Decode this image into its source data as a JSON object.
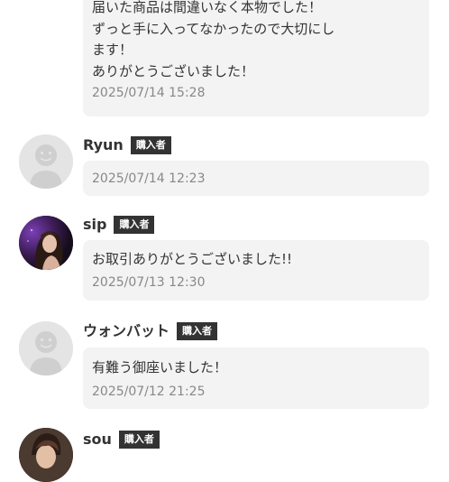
{
  "reviews": [
    {
      "name": "",
      "badge": "",
      "message_lines": [
        "届いた商品は間違いなく本物でした！",
        "ずっと手に入ってなかったので大切にし",
        "ます！",
        "ありがとうございました！"
      ],
      "timestamp": "2025/07/14 15:28"
    },
    {
      "name": "Ryun",
      "badge": "購入者",
      "avatar": "default-person-icon",
      "message_lines": [],
      "timestamp": "2025/07/14 12:23"
    },
    {
      "name": "sip",
      "badge": "購入者",
      "avatar": "user-photo",
      "message_lines": [
        "お取引ありがとうございました!!"
      ],
      "timestamp": "2025/07/13 12:30"
    },
    {
      "name": "ウォンバット",
      "badge": "購入者",
      "avatar": "default-person-icon",
      "message_lines": [
        "有難う御座いました！"
      ],
      "timestamp": "2025/07/12 21:25"
    },
    {
      "name": "sou",
      "badge": "購入者",
      "avatar": "user-photo"
    }
  ],
  "colors": {
    "bubble": "#f3f3f3",
    "badge": "#333333",
    "text": "#333333",
    "timestamp": "#888888",
    "avatar_default": "#e4e4e4"
  }
}
